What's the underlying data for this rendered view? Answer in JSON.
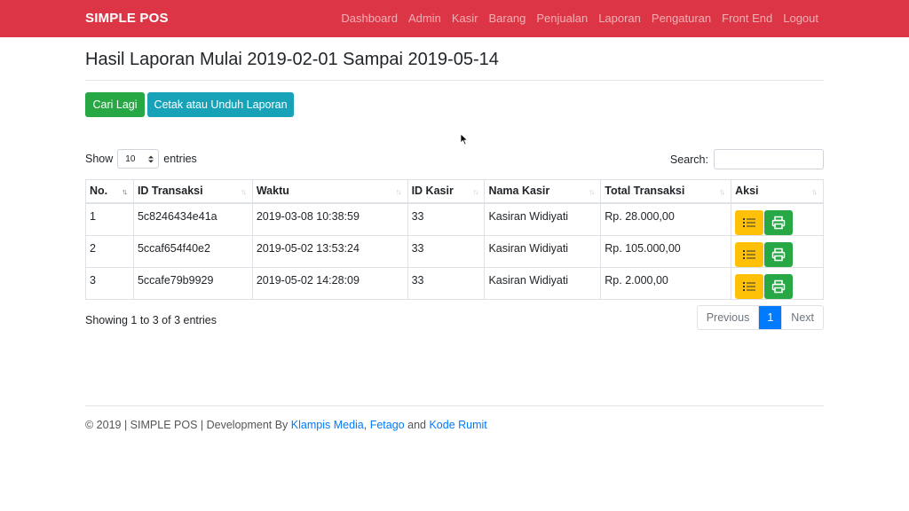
{
  "navbar": {
    "brand": "SIMPLE POS",
    "links": [
      "Dashboard",
      "Admin",
      "Kasir",
      "Barang",
      "Penjualan",
      "Laporan",
      "Pengaturan",
      "Front End",
      "Logout"
    ],
    "color": "#dc3545"
  },
  "page": {
    "title": "Hasil Laporan Mulai 2019-02-01 Sampai 2019-05-14"
  },
  "actions": {
    "cari_label": "Cari Lagi",
    "cetak_label": "Cetak atau Unduh Laporan"
  },
  "table_controls": {
    "show_label": "Show",
    "entries_value": "10",
    "entries_label": "entries",
    "search_label": "Search:",
    "search_value": ""
  },
  "table": {
    "headers": [
      "No.",
      "ID Transaksi",
      "Waktu",
      "ID Kasir",
      "Nama Kasir",
      "Total Transaksi",
      "Aksi"
    ],
    "sorted_column": "No.",
    "rows": [
      [
        "1",
        "5c8246434e41a",
        "2019-03-08 10:38:59",
        "33",
        "Kasiran Widiyati",
        "Rp. 28.000,00"
      ],
      [
        "2",
        "5ccaf654f40e2",
        "2019-05-02 13:53:24",
        "33",
        "Kasiran Widiyati",
        "Rp. 105.000,00"
      ],
      [
        "3",
        "5ccafe79b9929",
        "2019-05-02 14:28:09",
        "33",
        "Kasiran Widiyati",
        "Rp. 2.000,00"
      ]
    ],
    "row_action_icons": [
      "list-icon",
      "printer-icon"
    ]
  },
  "pagination": {
    "info": "Showing 1 to 3 of 3 entries",
    "previous": "Previous",
    "current": "1",
    "next": "Next"
  },
  "footer": {
    "prefix": "© 2019 | SIMPLE POS | Development By ",
    "link1": "Klampis Media",
    "sep1": ", ",
    "link2": "Fetago",
    "sep2": " and ",
    "link3": "Kode Rumit"
  }
}
